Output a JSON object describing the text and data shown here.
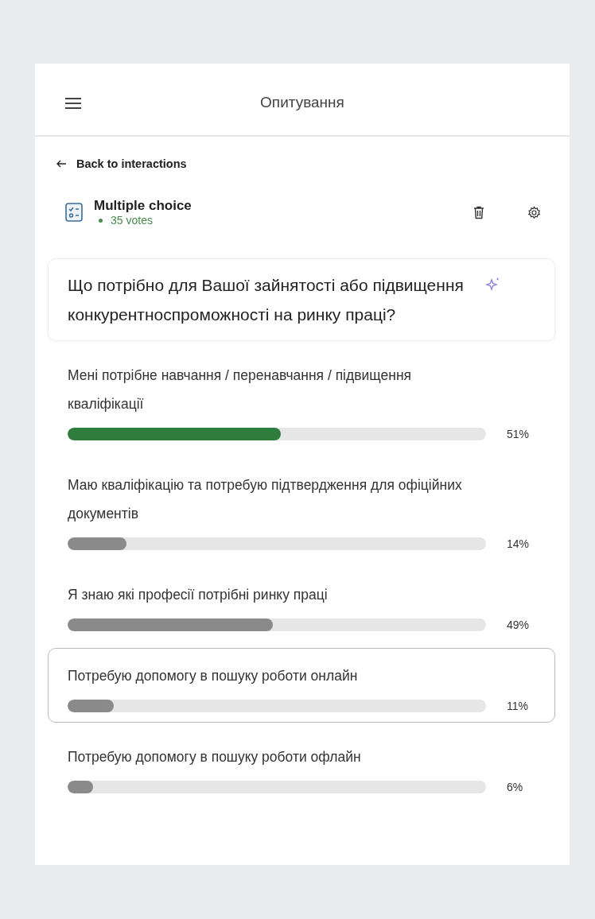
{
  "header": {
    "title": "Опитування"
  },
  "back_link": "Back to interactions",
  "interaction": {
    "type": "Multiple choice",
    "votes": "35 votes"
  },
  "question": "Що потрібно для Вашої зайнятості або підвищення конкурентноспроможності на ринку праці?",
  "options": [
    {
      "label": "Мені потрібне навчання / перенавчання / підвищення кваліфікації",
      "level": 0.51,
      "percent": "51%",
      "color": "#2e7d3c",
      "selected": false
    },
    {
      "label": "Маю кваліфікацію та потребую підтвердження для офіційних документів",
      "level": 0.14,
      "percent": "14%",
      "color": "#8a8a8a",
      "selected": false
    },
    {
      "label": "Я знаю які професії потрібні ринку праці",
      "level": 0.49,
      "percent": "49%",
      "color": "#8a8a8a",
      "selected": false
    },
    {
      "label": "Потребую допомогу в пошуку роботи онлайн",
      "level": 0.11,
      "percent": "11%",
      "color": "#8a8a8a",
      "selected": true
    },
    {
      "label": "Потребую допомогу в пошуку роботи офлайн",
      "level": 0.06,
      "percent": "6%",
      "color": "#8a8a8a",
      "selected": false
    }
  ]
}
